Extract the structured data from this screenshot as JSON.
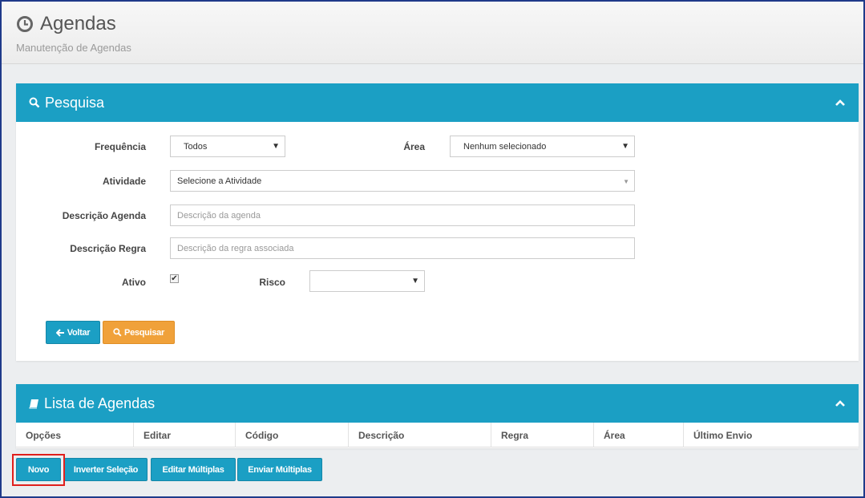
{
  "header": {
    "title": "Agendas",
    "subtitle": "Manutenção de Agendas"
  },
  "search_panel": {
    "title": "Pesquisa",
    "fields": {
      "frequencia": {
        "label": "Frequência",
        "value": "Todos"
      },
      "area": {
        "label": "Área",
        "value": "Nenhum selecionado"
      },
      "atividade": {
        "label": "Atividade",
        "value": "Selecione a Atividade"
      },
      "descricao_agenda": {
        "label": "Descrição Agenda",
        "placeholder": "Descrição da agenda"
      },
      "descricao_regra": {
        "label": "Descrição Regra",
        "placeholder": "Descrição da regra associada"
      },
      "ativo": {
        "label": "Ativo",
        "checked": true
      },
      "risco": {
        "label": "Risco",
        "value": ""
      }
    },
    "buttons": {
      "voltar": "Voltar",
      "pesquisar": "Pesquisar"
    }
  },
  "list_panel": {
    "title": "Lista de Agendas",
    "columns": [
      "Opções",
      "Editar",
      "Código",
      "Descrição",
      "Regra",
      "Área",
      "Último Envio"
    ]
  },
  "actions": {
    "novo": "Novo",
    "inverter_selecao": "Inverter Seleção",
    "editar_multiplas": "Editar Múltiplas",
    "enviar_multiplas": "Enviar Múltiplas"
  },
  "colors": {
    "primary": "#1b9fc4",
    "warning": "#f0a13a",
    "highlight": "#e0201d"
  }
}
